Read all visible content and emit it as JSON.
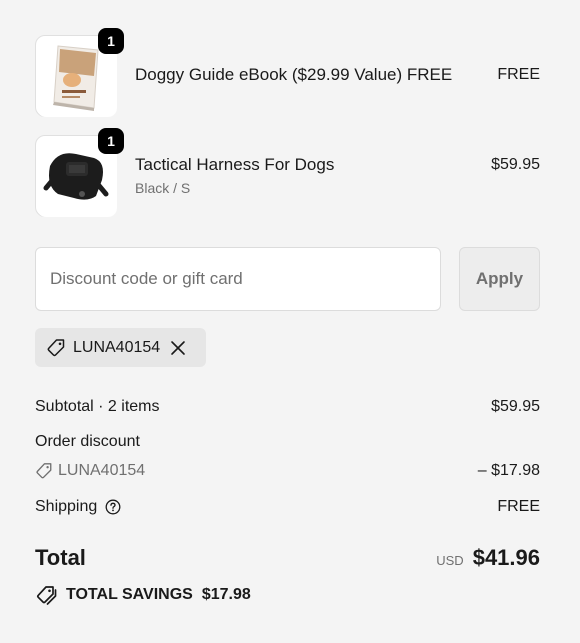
{
  "items": [
    {
      "name": "Doggy Guide eBook ($29.99 Value) FREE",
      "variant": "",
      "price": "FREE",
      "quantity": "1",
      "image_icon": "ebook-cover-icon"
    },
    {
      "name": "Tactical Harness For Dogs",
      "variant": "Black / S",
      "price": "$59.95",
      "quantity": "1",
      "image_icon": "dog-harness-icon"
    }
  ],
  "discount": {
    "placeholder": "Discount code or gift card",
    "apply_label": "Apply",
    "applied_code": "LUNA40154"
  },
  "summary": {
    "subtotal_label": "Subtotal · 2 items",
    "subtotal_value": "$59.95",
    "order_discount_label": "Order discount",
    "discount_code": "LUNA40154",
    "discount_value": "– $17.98",
    "shipping_label": "Shipping",
    "shipping_value": "FREE",
    "total_label": "Total",
    "currency": "USD",
    "total_value": "$41.96",
    "savings_label": "TOTAL SAVINGS",
    "savings_value": "$17.98"
  },
  "colors": {
    "background": "#f4f4f4",
    "text": "#1a1a1a",
    "muted": "#707070",
    "badge": "#000000"
  }
}
